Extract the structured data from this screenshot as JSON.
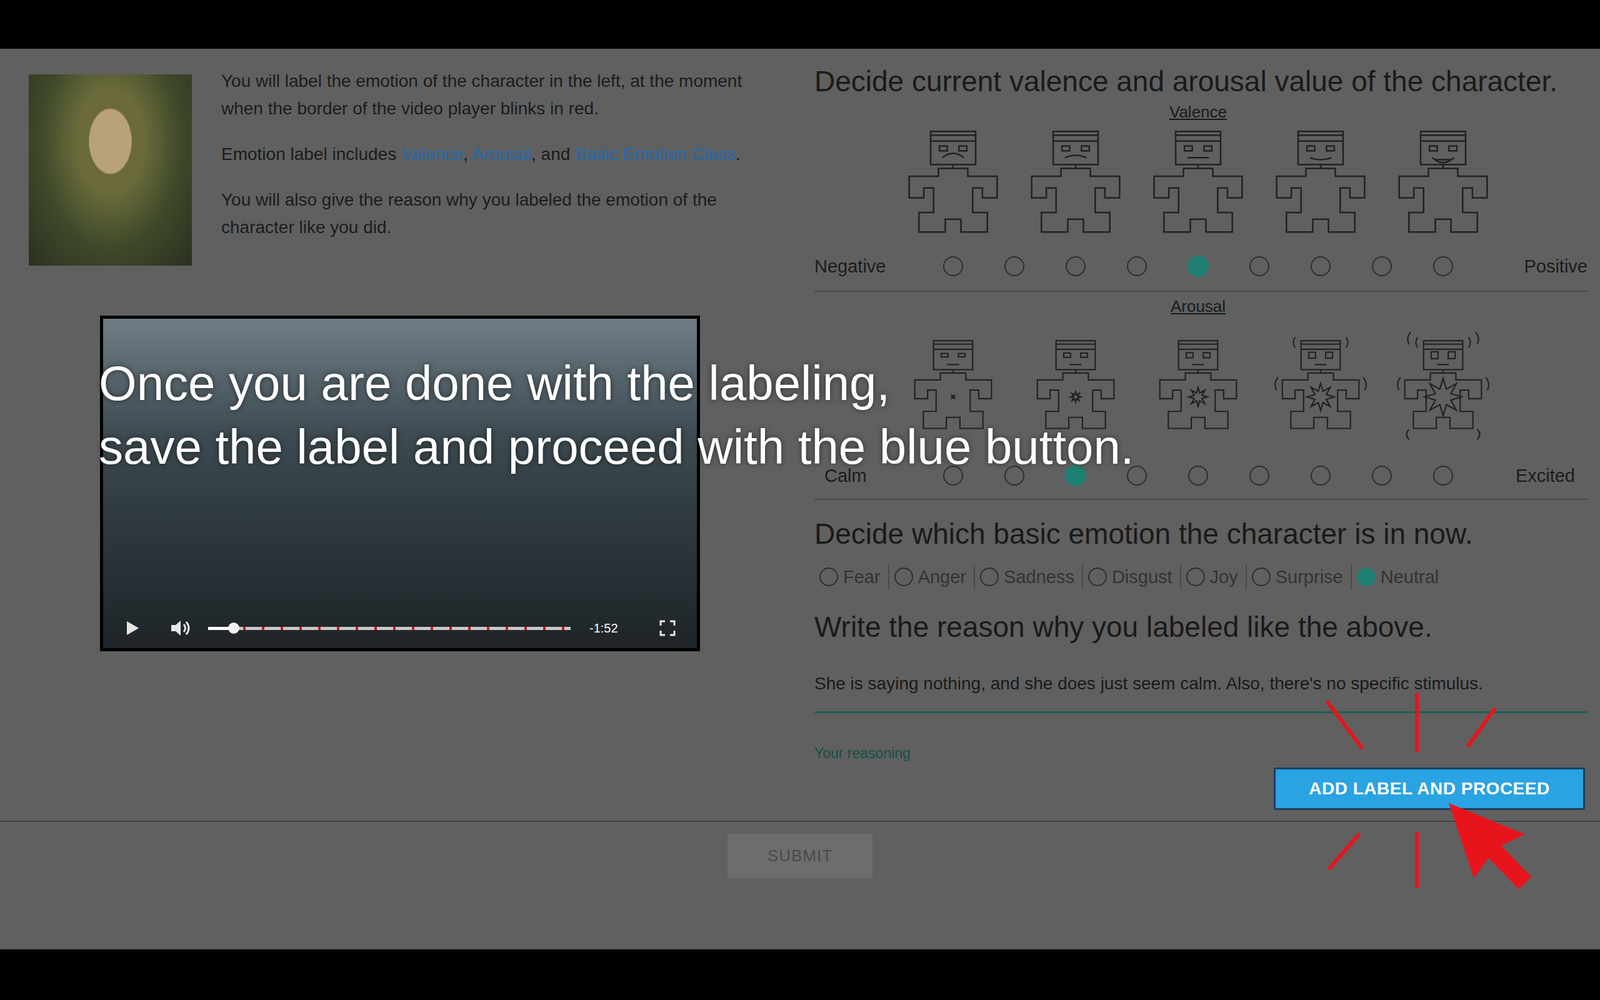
{
  "overlay": {
    "lines": [
      "Once you are done with the labeling,",
      "save the label and proceed with the blue button."
    ]
  },
  "intro": [
    [
      {
        "text": "You will label the emotion of the character in the left, at the moment when the border of the video player blinks in red.",
        "kind": "text"
      }
    ],
    [
      {
        "text": "Emotion label includes ",
        "kind": "text"
      },
      {
        "text": "Valence",
        "kind": "link"
      },
      {
        "text": ", ",
        "kind": "text"
      },
      {
        "text": "Arousal",
        "kind": "link"
      },
      {
        "text": ", and ",
        "kind": "text"
      },
      {
        "text": "Basic Emotion Class",
        "kind": "link"
      },
      {
        "text": ".",
        "kind": "text"
      }
    ],
    [
      {
        "text": "You will also give the reason why you labeled the emotion of the character like you did.",
        "kind": "text"
      }
    ]
  ],
  "video": {
    "time": "-1:52",
    "level": 0.07
  },
  "heading": "Decide current valence and arousal value of the character.",
  "scales": [
    {
      "title": "Valence",
      "kind": "valence",
      "left": "Negative",
      "right": "Positive",
      "points": [
        {
          "selected": false
        },
        {
          "selected": false
        },
        {
          "selected": false
        },
        {
          "selected": false
        },
        {
          "selected": true
        },
        {
          "selected": false
        },
        {
          "selected": false
        },
        {
          "selected": false
        },
        {
          "selected": false
        }
      ]
    },
    {
      "title": "Arousal",
      "kind": "arousal",
      "left": "Calm",
      "right": "Excited",
      "points": [
        {
          "selected": false
        },
        {
          "selected": false
        },
        {
          "selected": true
        },
        {
          "selected": false
        },
        {
          "selected": false
        },
        {
          "selected": false
        },
        {
          "selected": false
        },
        {
          "selected": false
        },
        {
          "selected": false
        }
      ]
    }
  ],
  "emotion": {
    "title": "Decide which basic emotion the character is in now.",
    "options": [
      {
        "label": "Fear",
        "selected": false
      },
      {
        "label": "Anger",
        "selected": false
      },
      {
        "label": "Sadness",
        "selected": false
      },
      {
        "label": "Disgust",
        "selected": false
      },
      {
        "label": "Joy",
        "selected": false
      },
      {
        "label": "Surprise",
        "selected": false
      },
      {
        "label": "Neutral",
        "selected": true
      }
    ]
  },
  "reason": {
    "title": "Write the reason why you labeled like the above.",
    "value": "She is saying nothing, and she does just seem calm. Also, there's no specific stimulus.",
    "helper": "Your reasoning"
  },
  "buttons": {
    "proceed": "ADD LABEL AND PROCEED",
    "submit": {
      "label": "SUBMIT",
      "disabled": true
    }
  }
}
